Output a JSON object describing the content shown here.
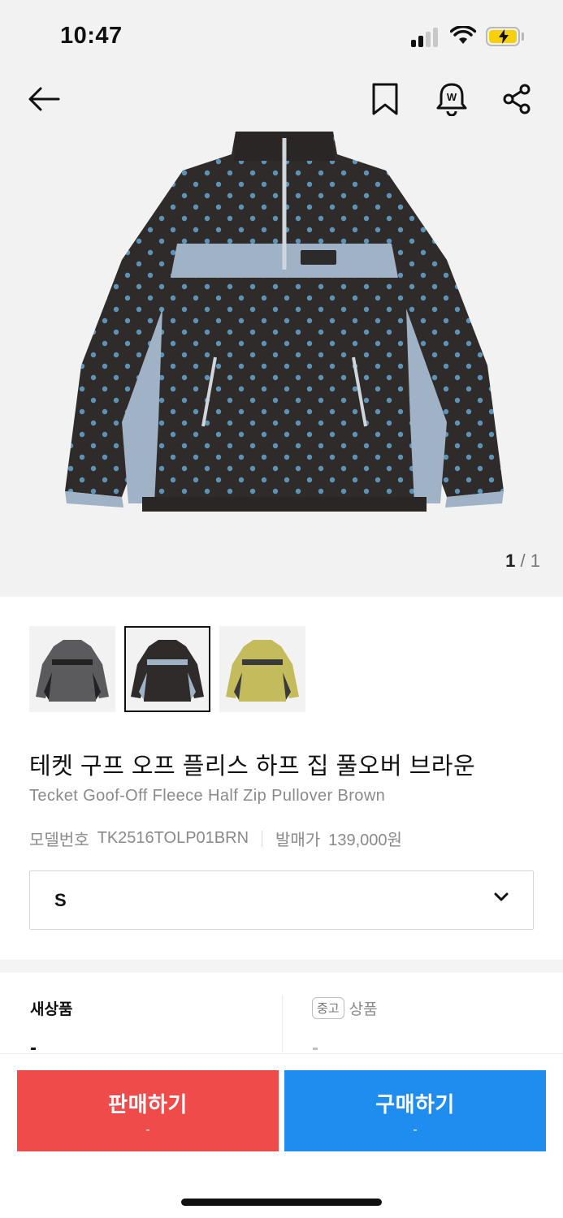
{
  "status_bar": {
    "time": "10:47",
    "battery_color": "#f6d10b"
  },
  "nav": {
    "back_icon": "arrow-left-icon",
    "bookmark_icon": "bookmark-icon",
    "alert_icon": "price-alert-bell-icon",
    "share_icon": "share-icon"
  },
  "gallery": {
    "current": "1",
    "separator": "/",
    "total": "1"
  },
  "thumbnails": [
    {
      "name": "charcoal"
    },
    {
      "name": "brown",
      "selected": true
    },
    {
      "name": "khaki"
    }
  ],
  "product": {
    "title_ko": "테켓 구프 오프 플리스 하프 집 풀오버 브라운",
    "title_en": "Tecket Goof-Off Fleece Half Zip Pullover Brown",
    "model_label": "모델번호",
    "model_value": "TK2516TOLP01BRN",
    "release_label": "발매가",
    "release_value": "139,000원"
  },
  "size_select": {
    "value": "S"
  },
  "prices": {
    "new_label": "새상품",
    "new_value": "-",
    "used_badge": "중고",
    "used_label": "상품",
    "used_value": "-"
  },
  "actions": {
    "sell_label": "판매하기",
    "sell_sub": "-",
    "buy_label": "구매하기",
    "buy_sub": "-",
    "sell_color": "#ef4b4b",
    "buy_color": "#1f8cf0"
  }
}
